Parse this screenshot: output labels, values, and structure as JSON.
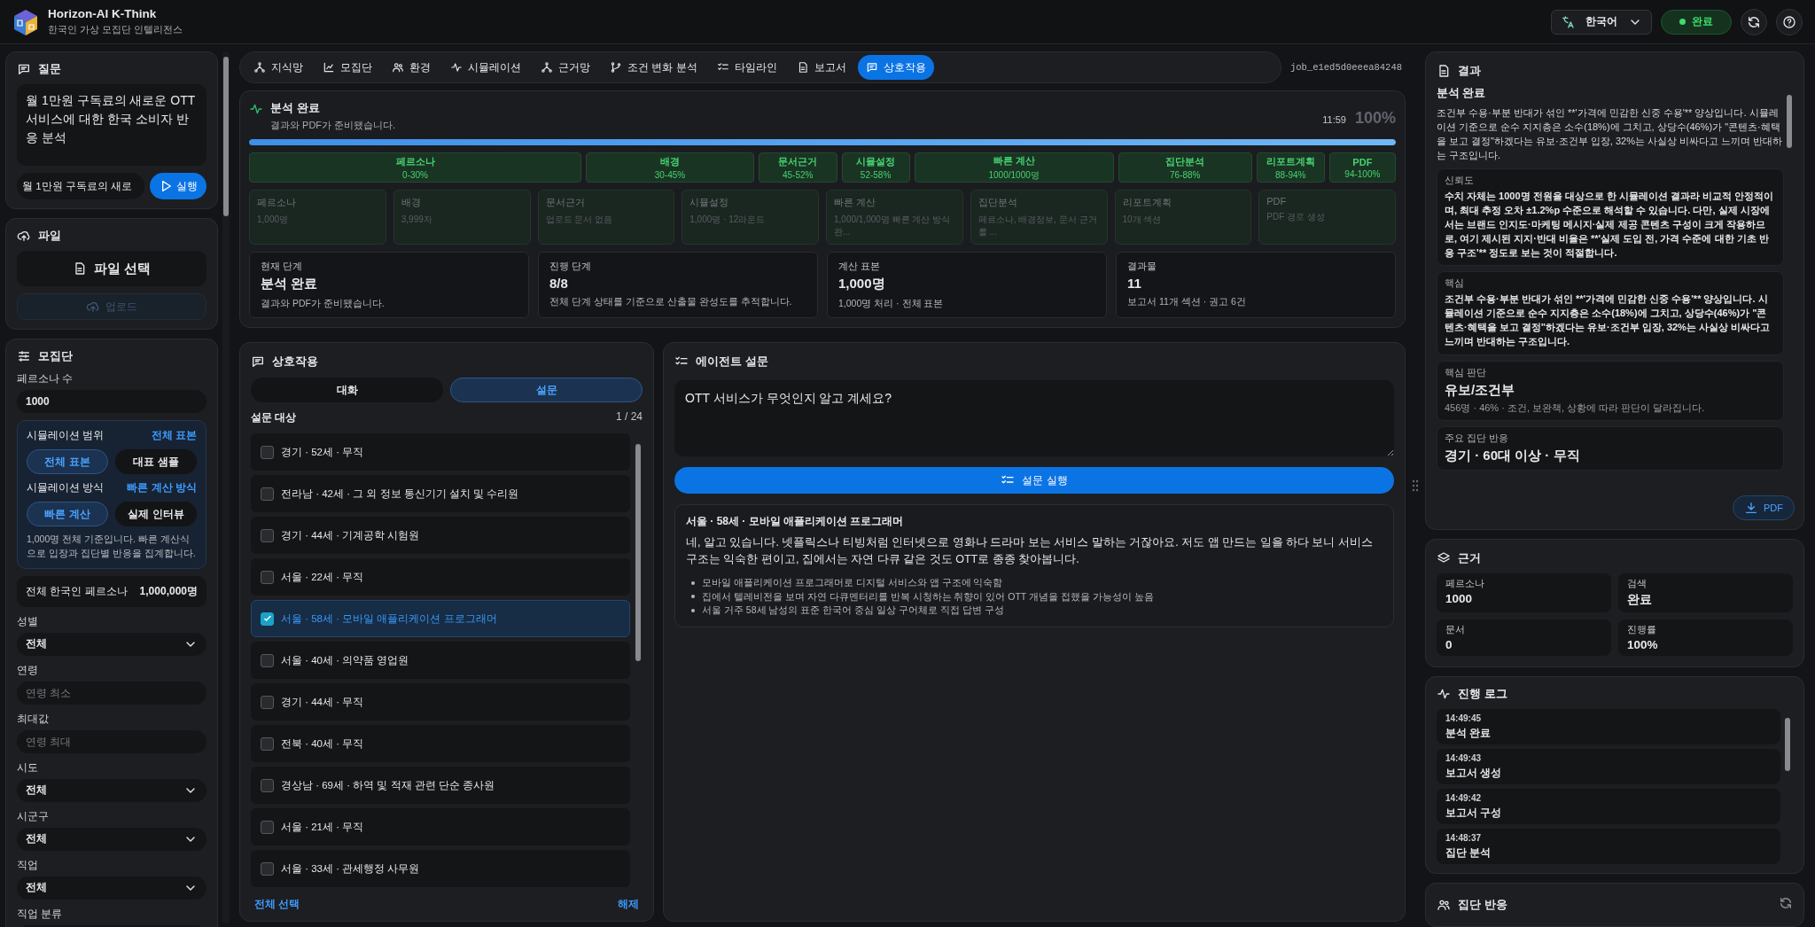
{
  "header": {
    "title": "Horizon-AI K-Think",
    "subtitle": "한국인 가상 모집단 인텔리전스",
    "language": "한국어",
    "status": {
      "label": "완료"
    }
  },
  "sidebar": {
    "question": {
      "title": "질문",
      "text": "월 1만원 구독료의 새로운 OTT 서비스에 대한 한국 소비자 반응 분석",
      "input_value": "월 1만원 구독료의 새로",
      "run_button": "실행"
    },
    "file": {
      "title": "파일",
      "select_button": "파일 선택",
      "upload_button": {
        "label": "업로드",
        "disabled": true
      }
    },
    "population": {
      "title": "모집단",
      "persona_count": {
        "label": "페르소나 수",
        "value": "1000"
      },
      "settings": [
        {
          "label": "시뮬레이션 범위",
          "current": "전체 표본",
          "options": [
            {
              "label": "전체 표본",
              "selected": true
            },
            {
              "label": "대표 샘플",
              "selected": false
            }
          ]
        },
        {
          "label": "시뮬레이션 방식",
          "current": "빠른 계산 방식",
          "options": [
            {
              "label": "빠른 계산",
              "selected": true
            },
            {
              "label": "실제 인터뷰",
              "selected": false
            }
          ]
        }
      ],
      "note": "1,000명 전체 기준입니다. 빠른 계산식으로 입장과 집단별 반응을 집계합니다.",
      "total": {
        "label": "전체 한국인 페르소나",
        "value": "1,000,000명"
      },
      "filters": [
        {
          "kind": "select",
          "label": "성별",
          "value": "전체"
        },
        {
          "kind": "input",
          "label": "연령",
          "placeholder": "연령 최소"
        },
        {
          "kind": "input",
          "label": "최대값",
          "placeholder": "연령 최대"
        },
        {
          "kind": "select",
          "label": "시도",
          "value": "전체"
        },
        {
          "kind": "select",
          "label": "시군구",
          "value": "전체"
        },
        {
          "kind": "select",
          "label": "직업",
          "value": "전체"
        },
        {
          "kind": "select",
          "label": "직업 분류"
        }
      ]
    }
  },
  "nav": {
    "tabs": [
      {
        "label": "지식망",
        "selected": false
      },
      {
        "label": "모집단",
        "selected": false
      },
      {
        "label": "환경",
        "selected": false
      },
      {
        "label": "시뮬레이션",
        "selected": false
      },
      {
        "label": "근거망",
        "selected": false
      },
      {
        "label": "조건 변화 분석",
        "selected": false
      },
      {
        "label": "타임라인",
        "selected": false
      },
      {
        "label": "보고서",
        "selected": false
      },
      {
        "label": "상호작용",
        "selected": true
      }
    ],
    "job_id": "job_e1ed5d0eeea84248"
  },
  "progress": {
    "title": "분석 완료",
    "subtitle": "결과와 PDF가 준비됐습니다.",
    "time": "11:59",
    "percent": "100%",
    "level": 1,
    "stages": [
      {
        "label": "페르소나",
        "range": "0-30%",
        "done": true
      },
      {
        "label": "배경",
        "range": "30-45%",
        "done": true
      },
      {
        "label": "문서근거",
        "range": "45-52%",
        "done": true
      },
      {
        "label": "시뮬설정",
        "range": "52-58%",
        "done": true
      },
      {
        "label": "빠른 계산",
        "range": "1000/1000명",
        "done": true
      },
      {
        "label": "집단분석",
        "range": "76-88%",
        "done": true
      },
      {
        "label": "리포트계획",
        "range": "88-94%",
        "done": true
      },
      {
        "label": "PDF",
        "range": "94-100%",
        "done": true
      }
    ],
    "details": [
      {
        "label": "페르소나",
        "value": "1,000명"
      },
      {
        "label": "배경",
        "value": "3,999자"
      },
      {
        "label": "문서근거",
        "value": "업로드 문서 없음"
      },
      {
        "label": "시뮬설정",
        "value": "1,000명 · 12라운드"
      },
      {
        "label": "빠른 계산",
        "value": "1,000/1,000명 빠른 계산 방식 완..."
      },
      {
        "label": "집단분석",
        "value": "페르소나, 배경정보, 문서 근거를 ..."
      },
      {
        "label": "리포트계획",
        "value": "10개 섹션"
      },
      {
        "label": "PDF",
        "value": "PDF 경로 생성"
      }
    ],
    "summary": [
      {
        "label": "현재 단계",
        "value": "분석 완료",
        "note": "결과와 PDF가 준비됐습니다."
      },
      {
        "label": "진행 단계",
        "value": "8/8",
        "note": "전체 단계 상태를 기준으로 산출물 완성도를 추적합니다."
      },
      {
        "label": "계산 표본",
        "value": "1,000명",
        "note": "1,000명 처리 · 전체 표본"
      },
      {
        "label": "결과물",
        "value": "11",
        "note": "보고서 11개 섹션 · 권고 6건"
      }
    ]
  },
  "interaction": {
    "title": "상호작용",
    "tabs": [
      {
        "label": "대화",
        "selected": false
      },
      {
        "label": "설문",
        "selected": true
      }
    ],
    "targets_label": "설문 대상",
    "page": "1 / 24",
    "targets": [
      {
        "label": "경기 · 52세 · 무직",
        "checked": false
      },
      {
        "label": "전라남 · 42세 · 그 외 정보 통신기기 설치 및 수리원",
        "checked": false
      },
      {
        "label": "경기 · 44세 · 기계공학 시험원",
        "checked": false
      },
      {
        "label": "서울 · 22세 · 무직",
        "checked": false
      },
      {
        "label": "서울 · 58세 · 모바일 애플리케이션 프로그래머",
        "checked": true
      },
      {
        "label": "서울 · 40세 · 의약품 영업원",
        "checked": false
      },
      {
        "label": "경기 · 44세 · 무직",
        "checked": false
      },
      {
        "label": "전북 · 40세 · 무직",
        "checked": false
      },
      {
        "label": "경상남 · 69세 · 하역 및 적재 관련 단순 종사원",
        "checked": false
      },
      {
        "label": "서울 · 21세 · 무직",
        "checked": false
      },
      {
        "label": "서울 · 33세 · 관세행정 사무원",
        "checked": false
      }
    ],
    "select_all": "전체 선택",
    "clear": "해제"
  },
  "agent_survey": {
    "title": "에이전트 설문",
    "question": "OTT 서비스가 무엇인지 알고 계세요?",
    "run_button": "설문 실행",
    "response": {
      "respondent": "서울 · 58세 · 모바일 애플리케이션 프로그래머",
      "answer": "네, 알고 있습니다. 넷플릭스나 티빙처럼 인터넷으로 영화나 드라마 보는 서비스 말하는 거잖아요. 저도 앱 만드는 일을 하다 보니 서비스 구조는 익숙한 편이고, 집에서는 자연 다큐 같은 것도 OTT로 종종 찾아봅니다.",
      "notes": [
        "모바일 애플리케이션 프로그래머로 디지털 서비스와 앱 구조에 익숙함",
        "집에서 텔레비전을 보며 자연 다큐멘터리를 반복 시청하는 취향이 있어 OTT 개념을 접했을 가능성이 높음",
        "서울 거주 58세 남성의 표준 한국어 중심 일상 구어체로 직접 답변 구성"
      ]
    }
  },
  "results": {
    "title": "결과",
    "heading": "분석 완료",
    "summary": "조건부 수용·부분 반대가 섞인 **'가격에 민감한 신중 수용'** 양상입니다. 시뮬레이션 기준으로 순수 지지층은 소수(18%)에 그치고, 상당수(46%)가 \"콘텐츠·혜택을 보고 결정\"하겠다는 유보·조건부 입장, 32%는 사실상 비싸다고 느끼며 반대하는 구조입니다.",
    "blocks": [
      {
        "kind": "text",
        "label": "신뢰도",
        "text": "수치 자체는 1000명 전원을 대상으로 한 시뮬레이션 결과라 비교적 안정적이며, 최대 추정 오차 ±1.2%p 수준으로 해석할 수 있습니다. 다만, 실제 시장에서는 브랜드 인지도·마케팅 메시지·실제 제공 콘텐츠 구성이 크게 작용하므로, 여기 제시된 지지·반대 비율은 **'실제 도입 전, 가격 수준에 대한 기초 반응 구조'** 정도로 보는 것이 적절합니다."
      },
      {
        "kind": "text",
        "label": "핵심",
        "text": "조건부 수용·부분 반대가 섞인 **'가격에 민감한 신중 수용'** 양상입니다. 시뮬레이션 기준으로 순수 지지층은 소수(18%)에 그치고, 상당수(46%)가 \"콘텐츠·혜택을 보고 결정\"하겠다는 유보·조건부 입장, 32%는 사실상 비싸다고 느끼며 반대하는 구조입니다."
      },
      {
        "kind": "highlight",
        "label": "핵심 판단",
        "value": "유보/조건부",
        "note": "456명 · 46% · 조건, 보완책, 상황에 따라 판단이 달라집니다."
      },
      {
        "kind": "highlight",
        "label": "주요 집단 반응",
        "value": "경기 · 60대 이상 · 무직"
      }
    ],
    "pdf_button": "PDF"
  },
  "evidence": {
    "title": "근거",
    "stats": [
      {
        "label": "페르소나",
        "value": "1000"
      },
      {
        "label": "검색",
        "value": "완료"
      },
      {
        "label": "문서",
        "value": "0"
      },
      {
        "label": "진행률",
        "value": "100%"
      }
    ]
  },
  "log": {
    "title": "진행 로그",
    "entries": [
      {
        "time": "14:49:45",
        "text": "분석 완료"
      },
      {
        "time": "14:49:43",
        "text": "보고서 생성"
      },
      {
        "time": "14:49:42",
        "text": "보고서 구성"
      },
      {
        "time": "14:48:37",
        "text": "집단 분석"
      }
    ]
  },
  "group_reaction": {
    "title": "집단 반응"
  }
}
